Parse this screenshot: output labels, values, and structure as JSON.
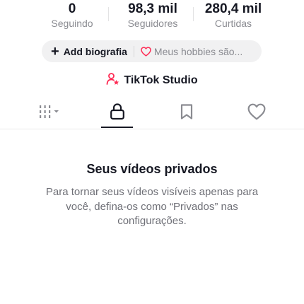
{
  "stats": [
    {
      "value": "0",
      "label": "Seguindo"
    },
    {
      "value": "98,3 mil",
      "label": "Seguidores"
    },
    {
      "value": "280,4 mil",
      "label": "Curtidas"
    }
  ],
  "bio": {
    "add_label": "Add biografia",
    "hobbies_hint": "Meus hobbies são..."
  },
  "studio": {
    "label": "TikTok Studio",
    "icon": "person-star-icon",
    "accent": "#fe2c55"
  },
  "tabs": [
    {
      "icon": "grid-filter-icon",
      "selected": false
    },
    {
      "icon": "lock-icon",
      "selected": true
    },
    {
      "icon": "bookmark-icon",
      "selected": false
    },
    {
      "icon": "heart-icon",
      "selected": false
    }
  ],
  "empty_state": {
    "title": "Seus vídeos privados",
    "description": "Para tornar seus vídeos visíveis apenas para você, defina-os como “Privados” nas configurações."
  },
  "colors": {
    "text_primary": "#161823",
    "text_secondary": "#8a8b91",
    "pill_bg": "#f1f1f2",
    "accent": "#fe2c55"
  }
}
